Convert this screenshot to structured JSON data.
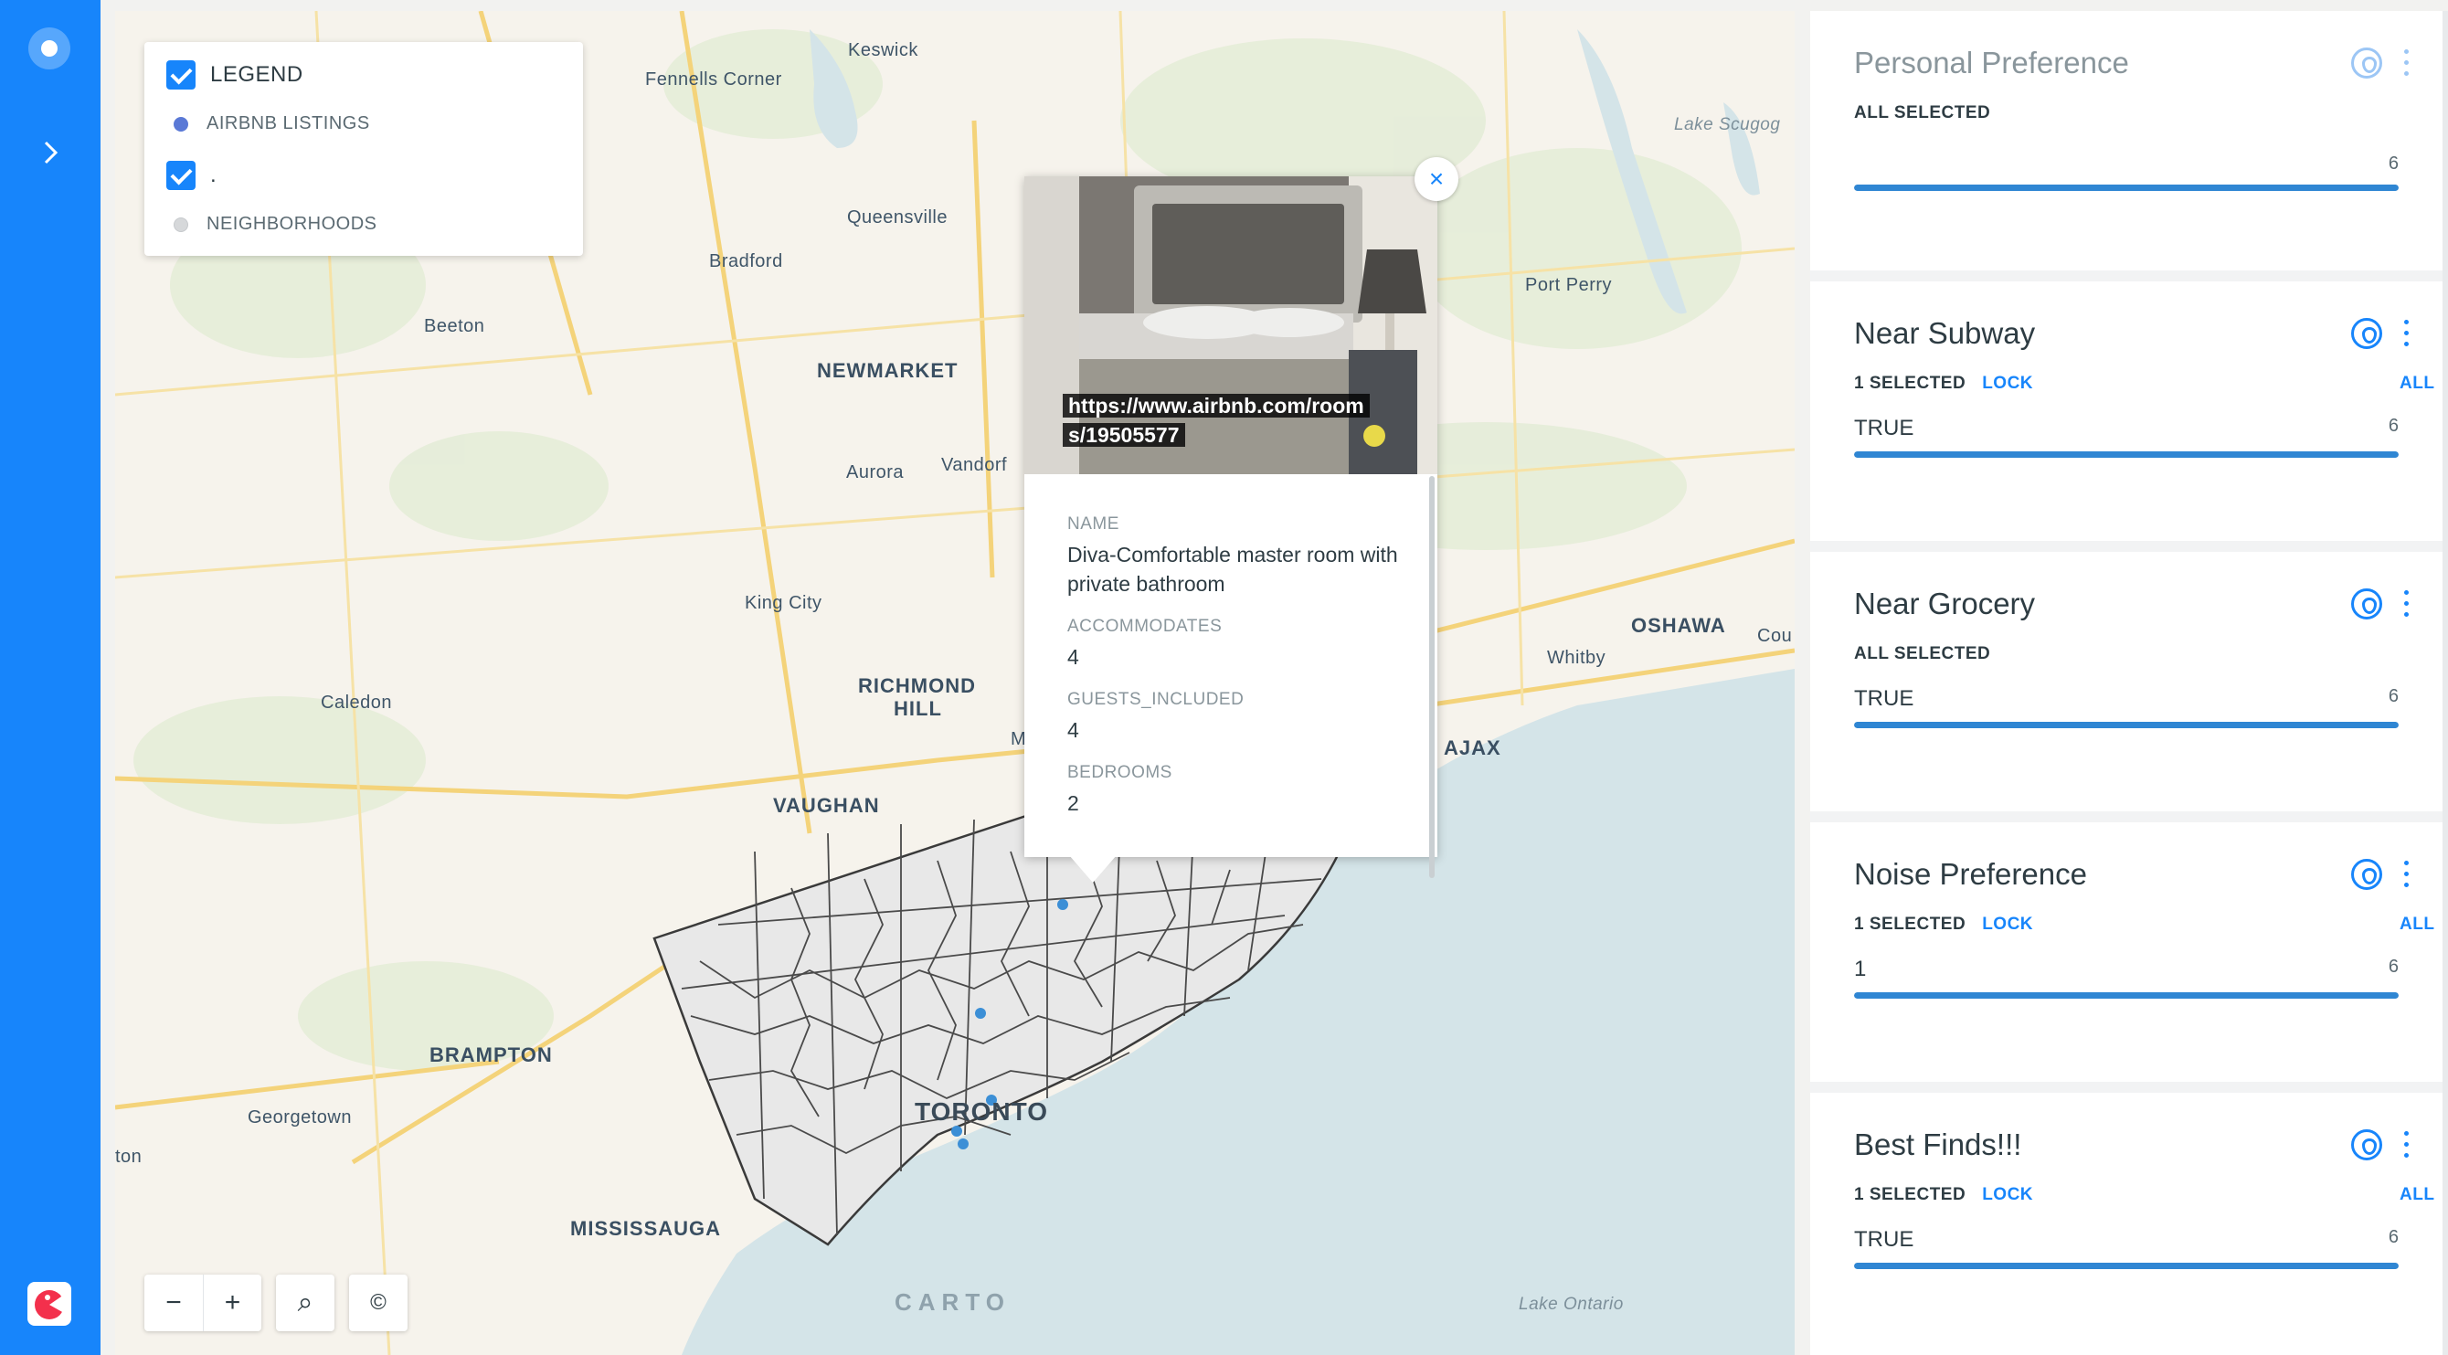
{
  "legend": {
    "title": "LEGEND",
    "layers": [
      {
        "label": "AIRBNB LISTINGS",
        "color": "#5a79d6"
      },
      {
        "label": "NEIGHBORHOODS",
        "color": "#d6d8da"
      }
    ],
    "second_checkbox_label": "."
  },
  "map": {
    "places": {
      "keswick": "Keswick",
      "fennells_corner": "Fennells Corner",
      "lake_scugog": "Lake Scugog",
      "queensville": "Queensville",
      "bradford": "Bradford",
      "port_perry": "Port Perry",
      "beeton": "Beeton",
      "newmarket": "NEWMARKET",
      "aurora": "Aurora",
      "vandorf": "Vandorf",
      "king_city": "King City",
      "oshawa": "OSHAWA",
      "courtice": "Cou",
      "whitby": "Whitby",
      "caledon": "Caledon",
      "richmond_hill_1": "RICHMOND",
      "richmond_hill_2": "HILL",
      "markham": "M",
      "ajax": "AJAX",
      "vaughan": "VAUGHAN",
      "brampton": "BRAMPTON",
      "toronto": "TORONTO",
      "georgetown": "Georgetown",
      "milton": "ton",
      "mississauga": "MISSISSAUGA",
      "lake_ontario": "Lake Ontario"
    },
    "attribution": "CARTO",
    "controls": {
      "zoom_out": "−",
      "zoom_in": "+",
      "search": "⌕",
      "info": "©"
    }
  },
  "popup": {
    "url": "https://www.airbnb.com/rooms/19505577",
    "url_line1": "https://www.airbnb.com/room",
    "url_line2": "s/19505577",
    "close": "×",
    "fields": [
      {
        "label": "NAME",
        "value": "Diva-Comfortable master room with private bathroom"
      },
      {
        "label": "ACCOMMODATES",
        "value": "4"
      },
      {
        "label": "GUESTS_INCLUDED",
        "value": "4"
      },
      {
        "label": "BEDROOMS",
        "value": "2"
      }
    ]
  },
  "widgets": [
    {
      "title": "Personal Preference",
      "status": "ALL SELECTED",
      "lock": "",
      "all": "",
      "category": "",
      "count": "6",
      "fill": 1.0
    },
    {
      "title": "Near Subway",
      "status": "1 SELECTED",
      "lock": "LOCK",
      "all": "ALL",
      "category": "TRUE",
      "count": "6",
      "fill": 1.0
    },
    {
      "title": "Near Grocery",
      "status": "ALL SELECTED",
      "lock": "",
      "all": "",
      "category": "TRUE",
      "count": "6",
      "fill": 1.0
    },
    {
      "title": "Noise Preference",
      "status": "1 SELECTED",
      "lock": "LOCK",
      "all": "ALL",
      "category": "1",
      "count": "6",
      "fill": 1.0
    },
    {
      "title": "Best Finds!!!",
      "status": "1 SELECTED",
      "lock": "LOCK",
      "all": "ALL",
      "category": "TRUE",
      "count": "6",
      "fill": 1.0
    }
  ],
  "colors": {
    "accent": "#1785fb",
    "bar": "#2f86d3",
    "water": "#d4e4e8",
    "land": "#f6f3ec",
    "roads": "#f4d37a"
  }
}
